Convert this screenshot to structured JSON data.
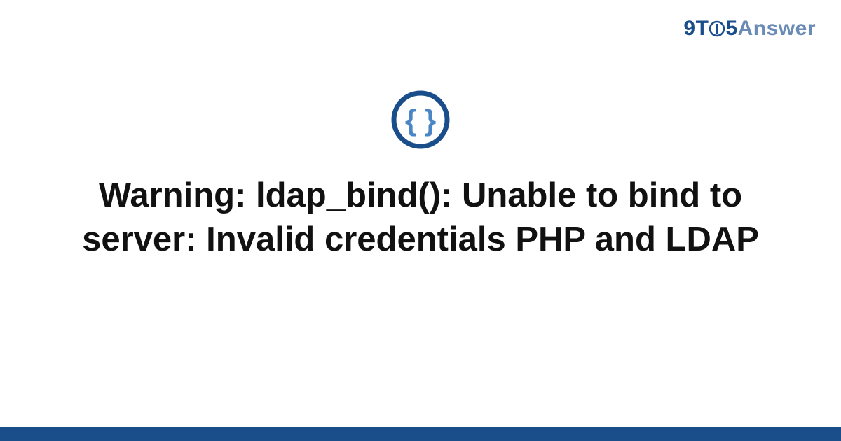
{
  "brand": {
    "prefix": "9T",
    "circle": "O",
    "mid": "5",
    "suffix": "Answer"
  },
  "icon": {
    "name": "braces-icon",
    "ring_color": "#1a4e8a",
    "glyph_color": "#4a86c5"
  },
  "headline": {
    "title": "Warning: ldap_bind(): Unable to bind to server: Invalid credentials PHP and LDAP"
  },
  "colors": {
    "accent": "#1a4e8a",
    "light": "#6a8bb5"
  }
}
